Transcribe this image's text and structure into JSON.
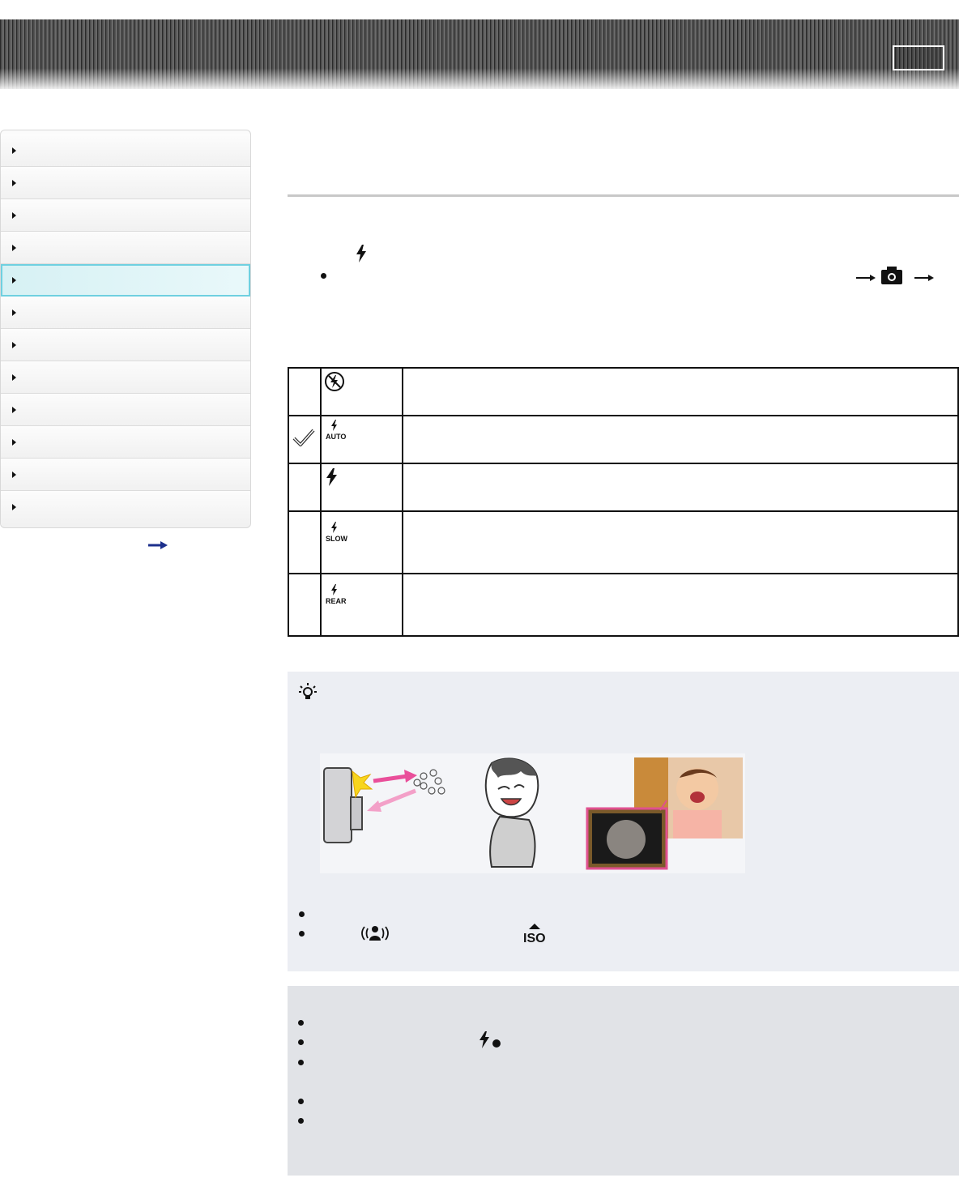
{
  "header": {
    "box_icon": "page-number-box"
  },
  "sidebar": {
    "item_count": 12,
    "active_index": 4,
    "more_icon": "arrow-right-icon"
  },
  "content": {
    "flash_icon": "flash-icon",
    "camera_icon": "camera-icon",
    "arrow_icon": "arrow-right-icon",
    "options": [
      {
        "icon": "flash-off-icon",
        "selected": false
      },
      {
        "icon": "flash-auto-icon",
        "selected": true,
        "icon_text": "AUTO"
      },
      {
        "icon": "flash-on-icon",
        "selected": false
      },
      {
        "icon": "slow-sync-icon",
        "selected": false,
        "icon_text": "SLOW"
      },
      {
        "icon": "rear-sync-icon",
        "selected": false,
        "icon_text": "REAR"
      }
    ]
  },
  "tip": {
    "icon": "hint-bulb-icon",
    "scene_icon": "anti-motion-blur-icon",
    "iso_text": "ISO"
  },
  "notes": {
    "flash_charge_icon": "flash-charging-icon",
    "bullet_count": 5
  },
  "colors": {
    "active_border": "#6fd0e0",
    "active_bg": "#d6f1f4",
    "accent_pink": "#e0508f"
  }
}
